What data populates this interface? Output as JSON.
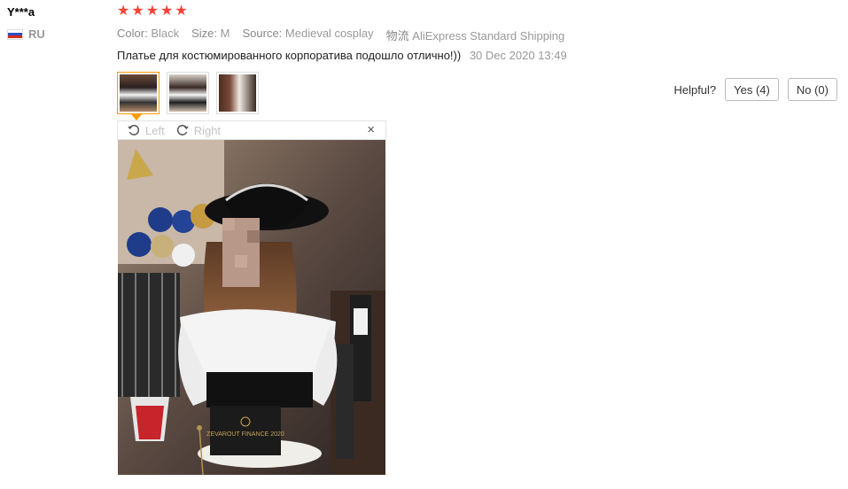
{
  "user": {
    "name": "Y***a",
    "country": "RU"
  },
  "rating": {
    "stars": 5,
    "star_color": "#f44336"
  },
  "properties": [
    {
      "label": "Color:",
      "value": "Black"
    },
    {
      "label": "Size:",
      "value": "M"
    },
    {
      "label": "Source:",
      "value": "Medieval cosplay"
    },
    {
      "label": "物流",
      "value": "AliExpress Standard Shipping"
    }
  ],
  "review": {
    "text": "Платье для костюмированного корпоратива подошло отлично!))",
    "date": "30 Dec 2020 13:49"
  },
  "thumbnails": [
    {
      "name": "photo-1",
      "active": true
    },
    {
      "name": "photo-2",
      "active": false
    },
    {
      "name": "photo-3",
      "active": false
    }
  ],
  "viewer": {
    "rotate_left": "Left",
    "rotate_right": "Right",
    "close_icon": "×",
    "card_text": "ZEVAROUT FINANCE 2020"
  },
  "helpful": {
    "label": "Helpful?",
    "yes": "Yes (4)",
    "no": "No (0)"
  },
  "colors": {
    "accent": "#f90",
    "muted": "#999"
  }
}
